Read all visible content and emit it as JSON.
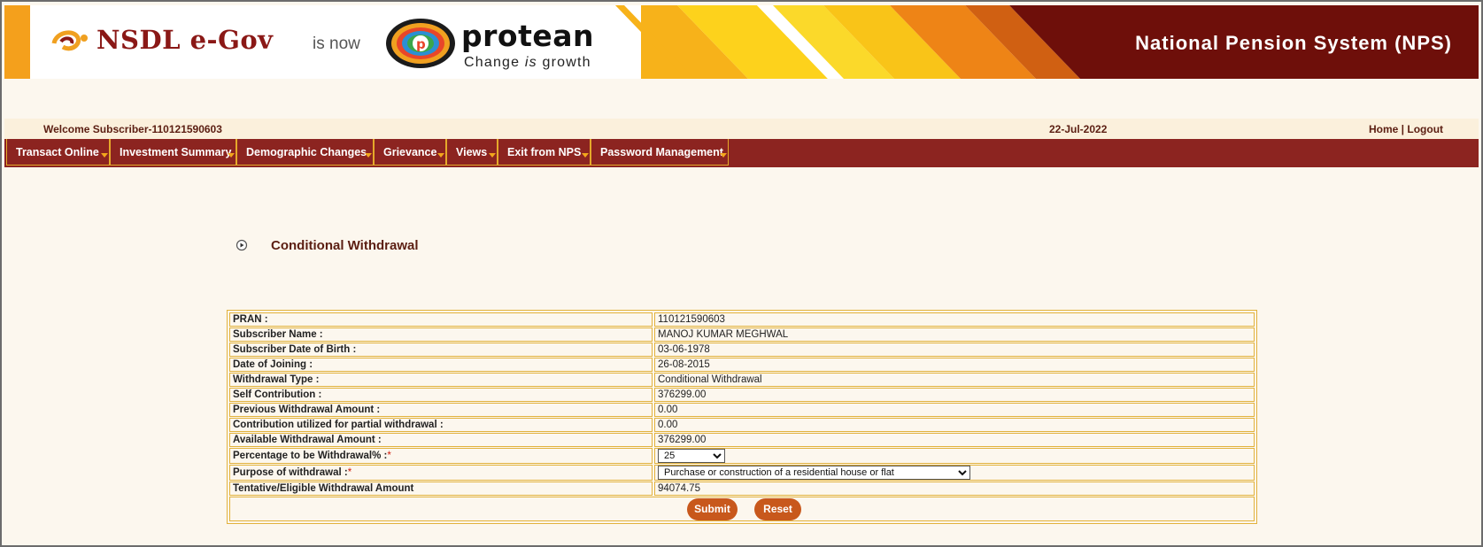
{
  "banner": {
    "brand_old": "NSDL e-Gov",
    "is_now": "is now",
    "brand_new": "protean",
    "tagline_before": "Change ",
    "tagline_italic": "is",
    "tagline_after": " growth",
    "system_title": "National Pension System (NPS)"
  },
  "colors": {
    "menu_bg": "#8c2420",
    "banner_dark": "#6e0f0a",
    "accent": "#f2a61c",
    "button": "#c8581c",
    "page_bg": "#fcf7ee"
  },
  "header": {
    "welcome": "Welcome Subscriber-110121590603",
    "date": "22-Jul-2022",
    "home": "Home",
    "separator": " | ",
    "logout": "Logout"
  },
  "menu": {
    "items": [
      {
        "label": "Transact Online"
      },
      {
        "label": "Investment Summary"
      },
      {
        "label": "Demographic Changes"
      },
      {
        "label": "Grievance"
      },
      {
        "label": "Views"
      },
      {
        "label": "Exit from NPS"
      },
      {
        "label": "Password Management"
      }
    ]
  },
  "section": {
    "icon": "circle-arrow-icon",
    "title": "Conditional Withdrawal"
  },
  "form": {
    "rows": [
      {
        "label": "PRAN :",
        "value": "110121590603"
      },
      {
        "label": "Subscriber Name :",
        "value": "MANOJ KUMAR MEGHWAL"
      },
      {
        "label": "Subscriber Date of Birth :",
        "value": "03-06-1978"
      },
      {
        "label": "Date of Joining :",
        "value": "26-08-2015"
      },
      {
        "label": "Withdrawal Type :",
        "value": "Conditional Withdrawal"
      },
      {
        "label": "Self Contribution :",
        "value": "376299.00"
      },
      {
        "label": "Previous Withdrawal Amount :",
        "value": "0.00"
      },
      {
        "label": "Contribution utilized for partial withdrawal :",
        "value": "0.00"
      },
      {
        "label": "Available Withdrawal Amount :",
        "value": "376299.00"
      }
    ],
    "percentage_label": "Percentage to be Withdrawal% :",
    "percentage_value": "25",
    "purpose_label": "Purpose of withdrawal :",
    "purpose_value": "Purchase or construction of a residential house or flat",
    "required_mark": "*",
    "eligible_label": "Tentative/Eligible Withdrawal Amount",
    "eligible_value": "94074.75",
    "submit": "Submit",
    "reset": "Reset"
  }
}
